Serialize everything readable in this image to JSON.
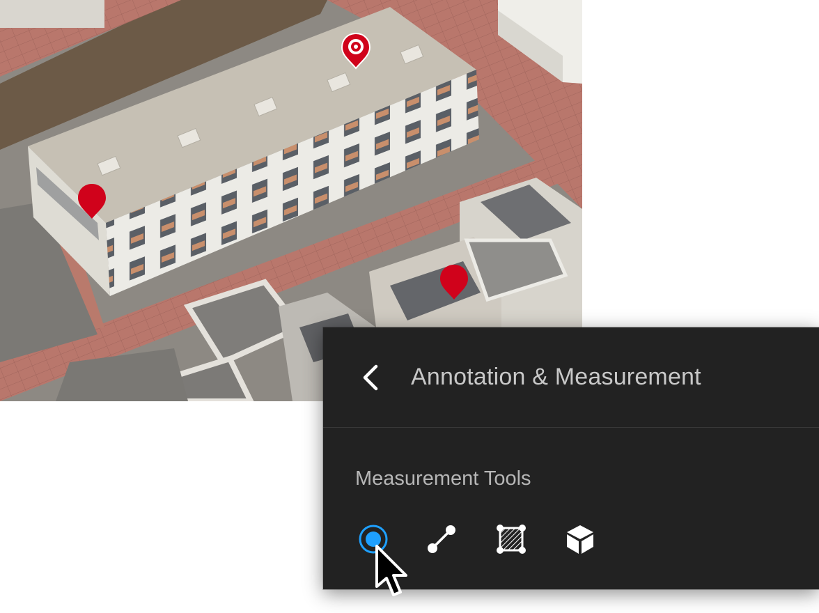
{
  "map": {
    "markers": [
      {
        "name": "pin-marker-selected",
        "icon": "location-pin-ring-icon"
      },
      {
        "name": "pin-marker-left",
        "icon": "location-pin-icon"
      },
      {
        "name": "pin-marker-right",
        "icon": "location-pin-icon"
      }
    ],
    "marker_color": "#d0021b"
  },
  "panel": {
    "back_icon": "chevron-left-icon",
    "title": "Annotation & Measurement",
    "section_label": "Measurement Tools",
    "tools": [
      {
        "name": "point-tool",
        "icon": "point-target-icon",
        "active": true
      },
      {
        "name": "distance-tool",
        "icon": "line-segment-icon",
        "active": false
      },
      {
        "name": "area-tool",
        "icon": "area-polygon-icon",
        "active": false
      },
      {
        "name": "volume-tool",
        "icon": "cube-icon",
        "active": false
      }
    ],
    "accent_color": "#1ea0ff",
    "background_color": "#222222"
  },
  "cursor": {
    "icon": "mouse-pointer-icon"
  }
}
